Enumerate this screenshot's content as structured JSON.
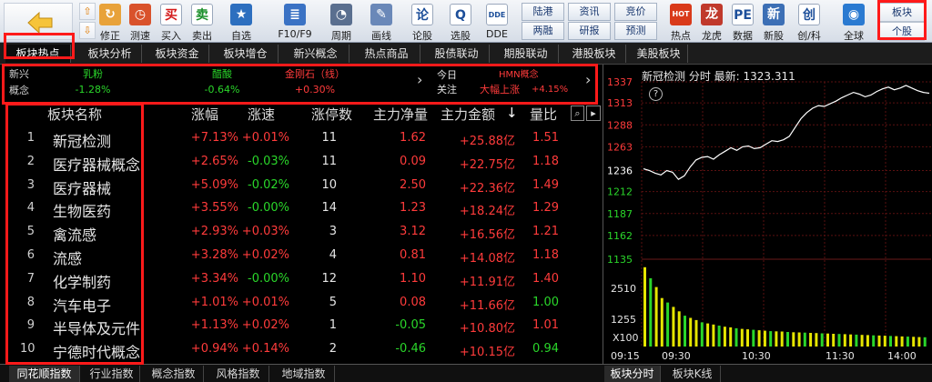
{
  "toolbar": {
    "buttons": [
      {
        "label": "修正",
        "icon": "correction-icon",
        "color": "#e8a23a",
        "glyph": "↻"
      },
      {
        "label": "测速",
        "icon": "clock-icon",
        "color": "#d9522b",
        "glyph": "◷"
      },
      {
        "label": "买入",
        "icon": "buy-icon",
        "color": "#ffffff",
        "glyph": "买",
        "glyph_color": "#d41a1a"
      },
      {
        "label": "卖出",
        "icon": "sell-icon",
        "color": "#ffffff",
        "glyph": "卖",
        "glyph_color": "#1a8f2a"
      },
      {
        "label": "自选",
        "icon": "watchlist-icon",
        "color": "#2d6fbf",
        "glyph": "★"
      },
      {
        "label": "F10/F9",
        "icon": "f10-icon",
        "color": "#3a72c4",
        "glyph": "≣"
      },
      {
        "label": "周期",
        "icon": "period-icon",
        "color": "#5a6f8f",
        "glyph": "◔"
      },
      {
        "label": "画线",
        "icon": "pen-icon",
        "color": "#6a88b8",
        "glyph": "✎"
      },
      {
        "label": "论股",
        "icon": "discuss-icon",
        "color": "#ffffff",
        "glyph": "论",
        "glyph_color": "#1d4f9a"
      },
      {
        "label": "选股",
        "icon": "stock-pick-icon",
        "color": "#ffffff",
        "glyph": "Q",
        "glyph_color": "#1d4f9a"
      },
      {
        "label": "DDE",
        "icon": "dde-icon",
        "color": "#ffffff",
        "glyph": "DDE",
        "glyph_color": "#1d4f9a"
      }
    ],
    "pairs": [
      {
        "top": "陆港",
        "bottom": "两融"
      },
      {
        "top": "资讯",
        "bottom": "研报"
      },
      {
        "top": "竞价",
        "bottom": "预测"
      }
    ],
    "buttons2": [
      {
        "label": "热点",
        "icon": "hot-icon",
        "color": "#d93a1a",
        "glyph": "HOT"
      },
      {
        "label": "龙虎",
        "icon": "dragon-tiger-icon",
        "color": "#c0392b",
        "glyph": "龙"
      },
      {
        "label": "数据",
        "icon": "data-icon",
        "color": "#ffffff",
        "glyph": "PE",
        "glyph_color": "#1d4f9a"
      },
      {
        "label": "新股",
        "icon": "new-stock-icon",
        "color": "#3c6fb5",
        "glyph": "新"
      },
      {
        "label": "创/科",
        "icon": "chuang-icon",
        "color": "#ffffff",
        "glyph": "创",
        "glyph_color": "#1d4f9a"
      },
      {
        "label": "全球",
        "icon": "globe-icon",
        "color": "#2a7ad1",
        "glyph": "◉"
      }
    ],
    "corner_top": "板块",
    "corner_bottom": "个股"
  },
  "tabs": [
    "板块热点",
    "板块分析",
    "板块资金",
    "板块增仓",
    "新兴概念",
    "热点商品",
    "股债联动",
    "期股联动",
    "港股板块",
    "美股板块"
  ],
  "ticker": {
    "left_label_1": "新兴",
    "left_label_2": "概念",
    "items": [
      {
        "name": "乳粉",
        "change": "-1.28%",
        "color": "#2ad62a"
      },
      {
        "name": "醋酸",
        "change": "-0.64%",
        "color": "#2ad62a"
      },
      {
        "name": "金刚石（线）",
        "change": "+0.30%",
        "color": "#ff3b3b"
      }
    ],
    "arrow": "›",
    "today_1": "今日",
    "today_2": "关注",
    "focus_name": "HMN概念",
    "focus_status": "大幅上涨",
    "focus_change": "+4.15%"
  },
  "table": {
    "headers": [
      "板块名称",
      "涨幅",
      "涨速",
      "涨停数",
      "主力净量",
      "主力金额",
      "量比"
    ],
    "sort_arrow": "↓",
    "rows": [
      {
        "idx": "1",
        "name": "新冠检测",
        "chg": "+7.13%",
        "speed": "+0.01%",
        "limit": "11",
        "net": "1.62",
        "amount": "+25.88亿",
        "ratio": "1.51"
      },
      {
        "idx": "2",
        "name": "医疗器械概念",
        "chg": "+2.65%",
        "speed": "-0.03%",
        "limit": "11",
        "net": "0.09",
        "amount": "+22.75亿",
        "ratio": "1.18"
      },
      {
        "idx": "3",
        "name": "医疗器械",
        "chg": "+5.09%",
        "speed": "-0.02%",
        "limit": "10",
        "net": "2.50",
        "amount": "+22.36亿",
        "ratio": "1.49"
      },
      {
        "idx": "4",
        "name": "生物医药",
        "chg": "+3.55%",
        "speed": "-0.00%",
        "limit": "14",
        "net": "1.23",
        "amount": "+18.24亿",
        "ratio": "1.29"
      },
      {
        "idx": "5",
        "name": "禽流感",
        "chg": "+2.93%",
        "speed": "+0.03%",
        "limit": "3",
        "net": "3.12",
        "amount": "+16.56亿",
        "ratio": "1.21"
      },
      {
        "idx": "6",
        "name": "流感",
        "chg": "+3.28%",
        "speed": "+0.02%",
        "limit": "4",
        "net": "0.81",
        "amount": "+14.08亿",
        "ratio": "1.18"
      },
      {
        "idx": "7",
        "name": "化学制药",
        "chg": "+3.34%",
        "speed": "-0.00%",
        "limit": "12",
        "net": "1.10",
        "amount": "+11.91亿",
        "ratio": "1.40"
      },
      {
        "idx": "8",
        "name": "汽车电子",
        "chg": "+1.01%",
        "speed": "+0.01%",
        "limit": "5",
        "net": "0.08",
        "amount": "+11.66亿",
        "ratio": "1.00"
      },
      {
        "idx": "9",
        "name": "半导体及元件",
        "chg": "+1.13%",
        "speed": "+0.02%",
        "limit": "1",
        "net": "-0.05",
        "amount": "+10.80亿",
        "ratio": "1.01"
      },
      {
        "idx": "10",
        "name": "宁德时代概念",
        "chg": "+0.94%",
        "speed": "+0.14%",
        "limit": "2",
        "net": "-0.46",
        "amount": "+10.15亿",
        "ratio": "0.94"
      }
    ]
  },
  "chart_panel": {
    "title": "新冠检测 分时 最新: 1323.311",
    "help": "?",
    "x100": "X100"
  },
  "chart_data": {
    "type": "line",
    "title": "新冠检测 分时 最新: 1323.311",
    "price_ticks": [
      "1337",
      "1313",
      "1288",
      "1263",
      "1236",
      "1212",
      "1187",
      "1162",
      "1135"
    ],
    "price_tick_colors": [
      "#ff3b3b",
      "#ff3b3b",
      "#ff3b3b",
      "#ff3b3b",
      "#ffffff",
      "#2ad62a",
      "#2ad62a",
      "#2ad62a",
      "#2ad62a"
    ],
    "ylim": [
      1135,
      1337
    ],
    "volume_ticks": [
      "2510",
      "1255"
    ],
    "x_ticks": [
      "09:15",
      "09:30",
      "10:30",
      "11:30",
      "14:00"
    ],
    "price_series": [
      1238,
      1236,
      1233,
      1231,
      1236,
      1234,
      1226,
      1230,
      1240,
      1248,
      1251,
      1252,
      1249,
      1254,
      1258,
      1262,
      1259,
      1263,
      1264,
      1261,
      1262,
      1266,
      1270,
      1269,
      1271,
      1275,
      1285,
      1295,
      1302,
      1307,
      1310,
      1309,
      1312,
      1315,
      1319,
      1322,
      1325,
      1323,
      1320,
      1322,
      1326,
      1329,
      1331,
      1328,
      1330,
      1333,
      1330,
      1327,
      1325,
      1324
    ],
    "volume_series": [
      3600,
      3100,
      2700,
      2200,
      2000,
      1800,
      1600,
      1400,
      1300,
      1200,
      1100,
      1050,
      1000,
      950,
      900,
      870,
      830,
      800,
      780,
      760,
      740,
      720,
      700,
      690,
      680,
      660,
      650,
      640,
      630,
      620,
      610,
      600,
      590,
      580,
      570,
      560,
      550,
      540,
      530,
      520,
      510,
      500,
      490,
      480,
      470,
      460,
      450,
      440,
      430,
      420
    ]
  },
  "bottom_tabs": [
    "同花顺指数",
    "行业指数",
    "概念指数",
    "风格指数",
    "地域指数"
  ],
  "bottom_right_tabs": [
    "板块分时",
    "板块K线"
  ]
}
